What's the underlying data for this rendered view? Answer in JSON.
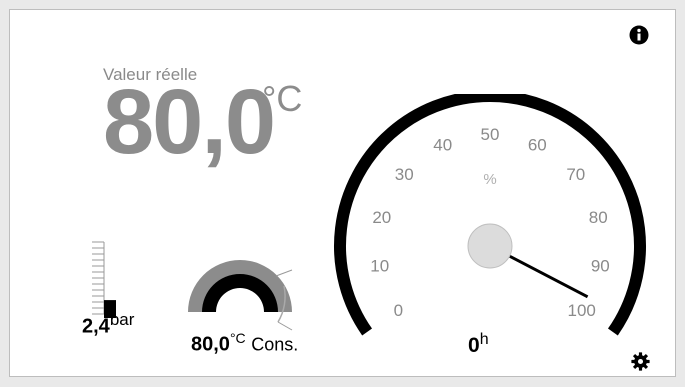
{
  "actual": {
    "label": "Valeur réelle",
    "value": "80,0",
    "unit": "°C"
  },
  "pressure": {
    "value": "2,4",
    "unit": "bar",
    "level": 0.3
  },
  "setpoint": {
    "value": "80,0",
    "unit": "°C",
    "label": "Cons."
  },
  "gauge": {
    "ticks": [
      "0",
      "10",
      "20",
      "30",
      "40",
      "50",
      "60",
      "70",
      "80",
      "90",
      "100"
    ],
    "unit_label": "%",
    "value_percent": 97
  },
  "hours": {
    "value": "0",
    "unit": "h"
  },
  "icons": {
    "info": "info-icon",
    "settings": "gear-icon"
  },
  "colors": {
    "accent": "#000000",
    "value_gray": "#8c8c8c",
    "dial_fill": "#dcdcdc"
  }
}
